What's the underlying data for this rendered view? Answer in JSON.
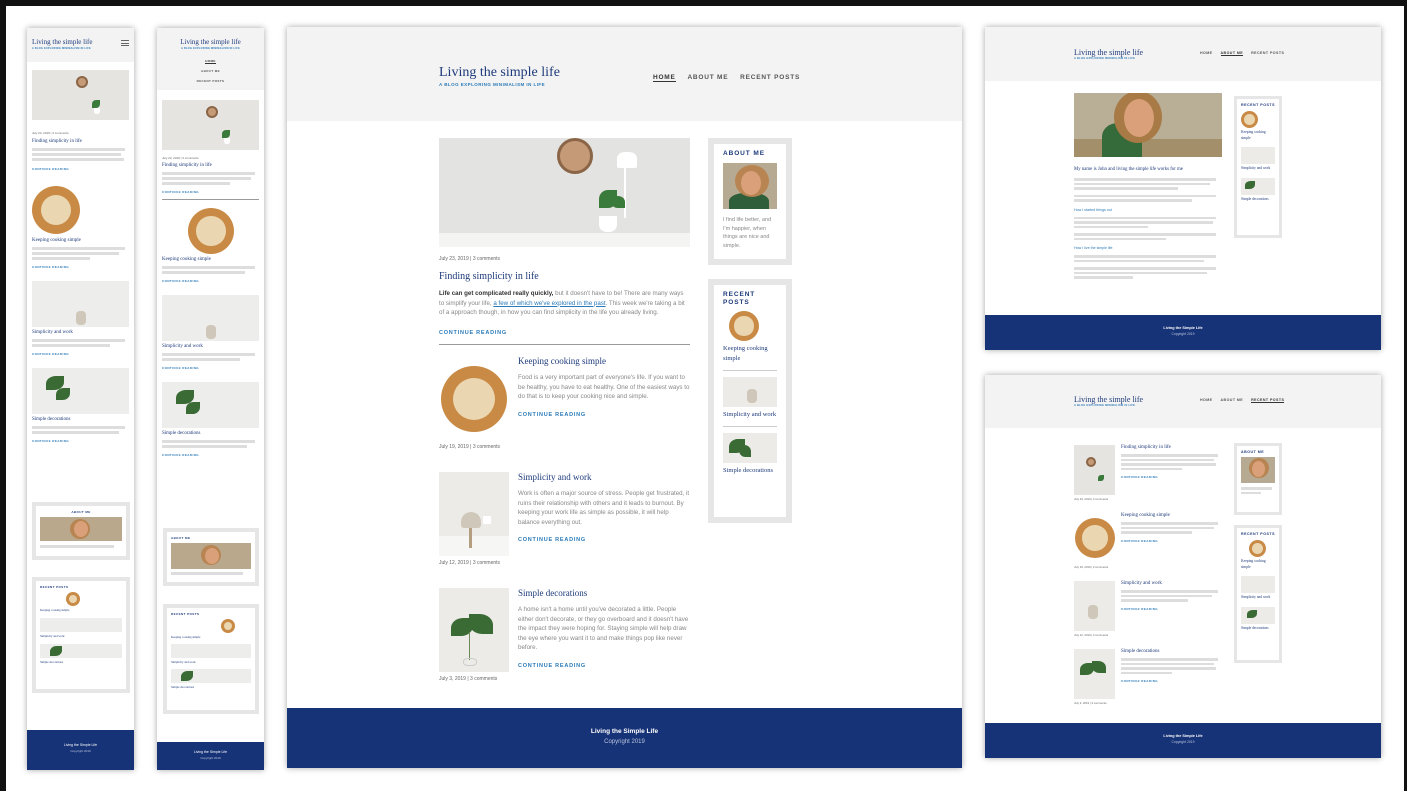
{
  "site": {
    "title": "Living the simple life",
    "tagline": "A blog exploring minimalism in life",
    "nav": [
      "Home",
      "About me",
      "Recent posts"
    ]
  },
  "featured": {
    "meta": "July 23, 2019 | 3 comments",
    "title": "Finding simplicity in life",
    "lead_bold": "Life can get complicated really quickly,",
    "lead_rest": " but it doesn't have to be! There are many ways to simplify your life, ",
    "link_text": "a few of which we've explored in the past",
    "lead_end": ". This week we're taking a bit of a approach though, in how you can find simplicity in the life you already living.",
    "cta": "Continue reading"
  },
  "posts": [
    {
      "title": "Keeping cooking simple",
      "meta": "July 19, 2019 | 3 comments",
      "excerpt": "Food is a very important part of everyone's life. If you want to be healthy, you have to eat healthy. One of the easiest ways to do that is to keep your cooking nice and simple.",
      "cta": "Continue reading"
    },
    {
      "title": "Simplicity and work",
      "meta": "July 12, 2019 | 3 comments",
      "excerpt": "Work is often a major source of stress. People get frustrated, it ruins their relationship with others and it leads to burnout. By keeping your work life as simple as possible, it will help balance everything out.",
      "cta": "Continue reading"
    },
    {
      "title": "Simple decorations",
      "meta": "July 3, 2019 | 3 comments",
      "excerpt": "A home isn't a home until you've decorated a little. People either don't decorate, or they go overboard and it doesn't have the impact they were hoping for. Staying simple will help draw the eye where you want it to and make things pop like never before.",
      "cta": "Continue reading"
    }
  ],
  "sidebar": {
    "about_title": "About me",
    "about_text": "I find life better, and I'm happier, when things are nice and simple.",
    "recent_title": "Recent posts",
    "recent": [
      "Keeping cooking simple",
      "Simplicity and work",
      "Simple decorations"
    ]
  },
  "about_page": {
    "heading": "My name is John and living the simple life works for me",
    "section_1": "How I started things out",
    "section_2": "How I live the simple life"
  },
  "footer": {
    "title": "Living the Simple Life",
    "copyright": "Copyright 2019"
  },
  "colors": {
    "brand": "#1d3a7a",
    "accent": "#2a7ab8",
    "footer": "#173377",
    "header_bg": "#f3f3f3"
  },
  "icons": {
    "menu": "hamburger-menu-icon"
  }
}
